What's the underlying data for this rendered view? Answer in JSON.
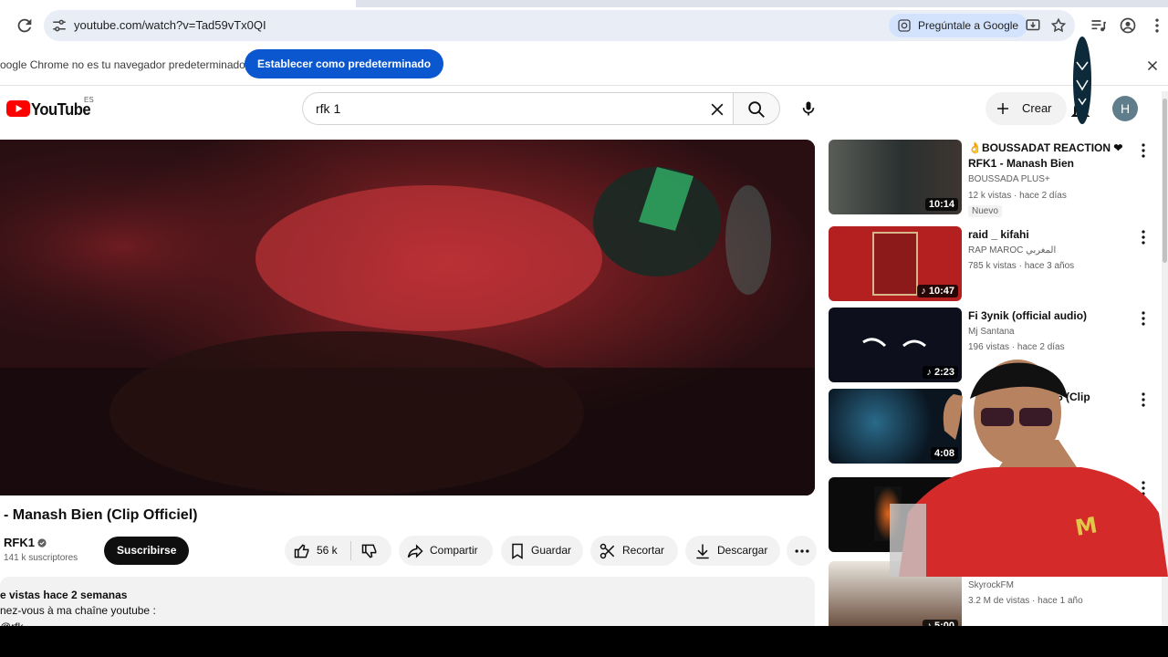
{
  "browser": {
    "url": "youtube.com/watch?v=Tad59vTx0QI",
    "ask_google": "Pregúntale a Google",
    "infobar_text": "oogle Chrome no es tu navegador predeterminado",
    "infobar_button": "Establecer como predeterminado"
  },
  "youtube": {
    "logo_text": "YouTube",
    "region": "ES",
    "search_value": "rfk 1",
    "create_label": "Crear",
    "avatar_letter": "H"
  },
  "video": {
    "title": "- Manash Bien (Clip Officiel)",
    "channel": "RFK1",
    "subscribers": "141 k suscriptores",
    "subscribe_label": "Suscribirse",
    "likes": "56 k",
    "share_label": "Compartir",
    "save_label": "Guardar",
    "clip_label": "Recortar",
    "download_label": "Descargar",
    "desc_meta": "e vistas  hace 2 semanas",
    "desc_line": "nez-vous à ma chaîne youtube :",
    "desc_line2": "@rfk"
  },
  "recommendations": [
    {
      "title": "👌BOUSSADAT REACTION ❤ RFK1 - Manash Bien",
      "channel": "BOUSSADA PLUS+",
      "meta": "12 k vistas · hace 2 días",
      "badge": "Nuevo",
      "duration": "10:14",
      "thumb_color": "#3a3f3a"
    },
    {
      "title": "raid _ kifahi",
      "channel": "RAP MAROC المغربي",
      "meta": "785 k vistas · hace 3 años",
      "duration": "♪ 10:47",
      "thumb_color": "#b3201f"
    },
    {
      "title": "Fi 3ynik (official audio)",
      "channel": "Mj Santana",
      "meta": "196 vistas · hace 2 días",
      "duration": "♪ 2:23",
      "thumb_color": "#0d0f1c"
    },
    {
      "title": "h Bien 5 (Clip",
      "channel": "",
      "meta": "",
      "duration": "4:08",
      "thumb_color": "#0a1520"
    },
    {
      "title": "",
      "channel": "",
      "meta": "",
      "duration": "",
      "thumb_color": "#111"
    },
    {
      "title": "",
      "channel": "SkyrockFM",
      "meta": "3.2 M de vistas · hace 1 año",
      "duration": "♪ 5:00",
      "thumb_color": "#3a2a20"
    }
  ],
  "colors": {
    "accent": "#0b57d0",
    "youtube_red": "#ff0000"
  }
}
